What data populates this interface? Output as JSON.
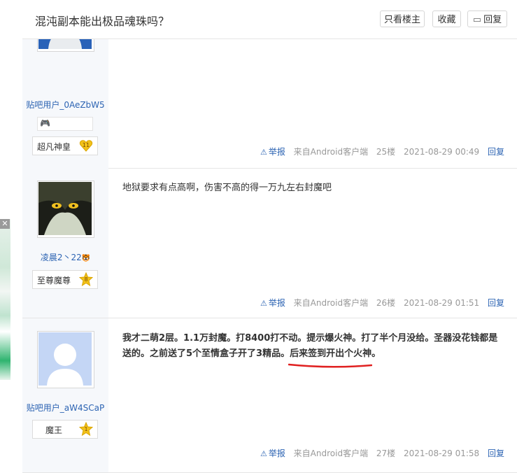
{
  "header": {
    "title": "混沌副本能出极品魂珠吗？",
    "btn_only_lz": "只看楼主",
    "btn_favorite": "收藏",
    "btn_reply": "回复"
  },
  "ad": {
    "close": "✕"
  },
  "posts": [
    {
      "username": "贴吧用户_0AeZbW5",
      "level_name": "超凡神皇",
      "level_num": "11",
      "text": "",
      "report": "举报",
      "source": "来自Android客户端",
      "floor": "25楼",
      "time": "2021-08-29 00:49",
      "reply": "回复"
    },
    {
      "username": "凌晨2丶22",
      "level_name": "至尊魔尊",
      "level_num": "8",
      "text": "地狱要求有点高啊，伤害不高的得一万九左右封魔吧",
      "report": "举报",
      "source": "来自Android客户端",
      "floor": "26楼",
      "time": "2021-08-29 01:51",
      "reply": "回复"
    },
    {
      "username": "贴吧用户_aW4SCaP",
      "level_name": "魔王",
      "level_num": "1",
      "text_line1": "我才二萌2层。1.1万封魔。打8400打不动。提示爆火神。打了半个月没给。圣器没花钱都是",
      "text_line2_a": "送的。之前送了5个至情盒子开了3精品。",
      "text_line2_b": "后来签到开出个火神。",
      "report": "举报",
      "source": "来自Android客户端",
      "floor": "27楼",
      "time": "2021-08-29 01:58",
      "reply": "回复"
    }
  ],
  "colors": {
    "accent_blue": "#2d64b3",
    "underline_red": "#e02020"
  }
}
